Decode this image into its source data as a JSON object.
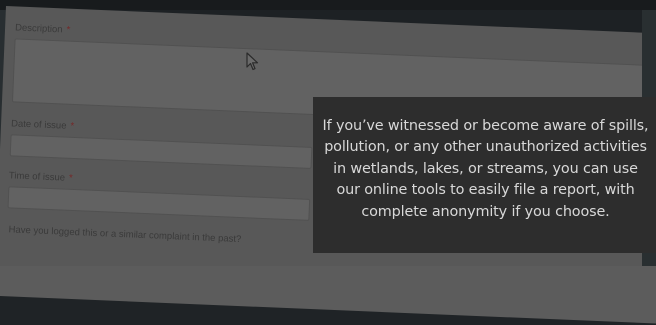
{
  "form": {
    "description_label": "Description",
    "date_label": "Date of issue",
    "time_label": "Time of issue",
    "logged_question": "Have you logged this or a similar complaint in the past?",
    "required_marker": "*"
  },
  "info_box": {
    "text": "If you’ve witnessed or become aware of spills, pollution, or any other unauthorized activities in wetlands, lakes, or streams, you can use our online tools to easily file a report, with complete anonymity if you choose."
  },
  "colors": {
    "overlay": "#2d2d2d",
    "info_text": "#d8d8d8",
    "required": "#7a2b2b"
  },
  "icons": [
    "mouse-pointer-icon"
  ]
}
